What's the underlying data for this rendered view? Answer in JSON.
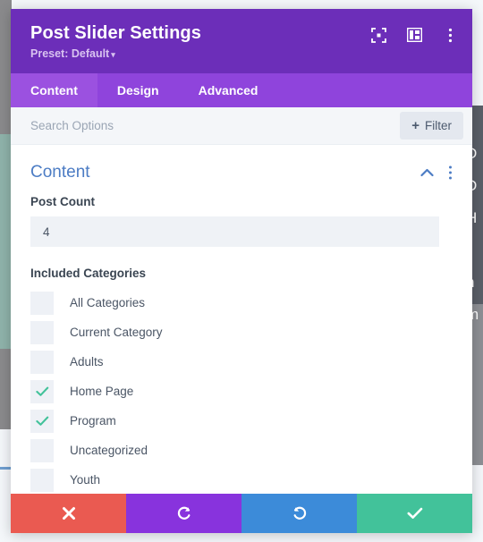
{
  "background": {
    "right_text_fragments": [
      "\\",
      "D",
      "D",
      "H",
      "r",
      "n",
      "m"
    ]
  },
  "modal": {
    "header": {
      "title": "Post Slider Settings",
      "preset_label": "Preset: Default",
      "preset_caret": "▾",
      "icons": [
        {
          "name": "fullscreen-icon",
          "label": "Fullscreen"
        },
        {
          "name": "layout-panel-icon",
          "label": "Change layout"
        },
        {
          "name": "more-options-icon",
          "label": "More options"
        }
      ]
    },
    "tabs": [
      {
        "label": "Content",
        "active": true
      },
      {
        "label": "Design",
        "active": false
      },
      {
        "label": "Advanced",
        "active": false
      }
    ],
    "search": {
      "placeholder": "Search Options",
      "value": "",
      "filter_label": "Filter",
      "filter_plus": "+"
    },
    "section": {
      "title": "Content",
      "collapse_icon": "chevron-up-icon",
      "menu_icon": "more-options-icon"
    },
    "fields": {
      "post_count": {
        "label": "Post Count",
        "value": "4",
        "placeholder": ""
      },
      "included_categories": {
        "label": "Included Categories",
        "options": [
          {
            "label": "All Categories",
            "checked": false
          },
          {
            "label": "Current Category",
            "checked": false
          },
          {
            "label": "Adults",
            "checked": false
          },
          {
            "label": "Home Page",
            "checked": true
          },
          {
            "label": "Program",
            "checked": true
          },
          {
            "label": "Uncategorized",
            "checked": false
          },
          {
            "label": "Youth",
            "checked": false
          }
        ]
      }
    },
    "actions": [
      {
        "name": "cancel-button",
        "icon": "close-icon",
        "glyph": "✖",
        "color": "#ea5a51"
      },
      {
        "name": "undo-button",
        "icon": "undo-icon",
        "glyph": "↺",
        "color": "#8833dd"
      },
      {
        "name": "redo-button",
        "icon": "redo-icon",
        "glyph": "↻",
        "color": "#3c8bd9"
      },
      {
        "name": "save-button",
        "icon": "checkmark-icon",
        "glyph": "✔",
        "color": "#42c29a"
      }
    ]
  },
  "colors": {
    "header_purple": "#6c2eb9",
    "tabbar_purple": "#8f44dc",
    "tab_active_purple": "#9b51e0",
    "section_blue": "#4c7cc4",
    "check_teal": "#42c29a"
  }
}
